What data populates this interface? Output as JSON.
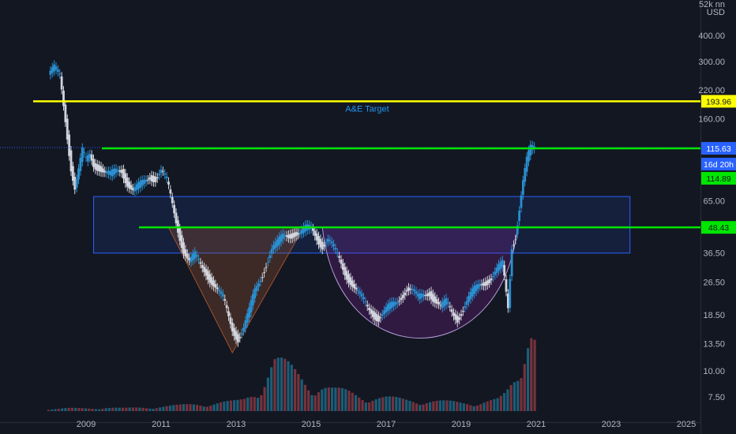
{
  "chart_data": {
    "type": "candlestick",
    "scale": "log",
    "currency": "USD",
    "header_text": "52k nn",
    "x_ticks": [
      "2009",
      "2011",
      "2013",
      "2015",
      "2017",
      "2019",
      "2021",
      "2023",
      "2025"
    ],
    "y_ticks": [
      400.0,
      300.0,
      220.0,
      160.0,
      65.0,
      36.5,
      26.5,
      18.5,
      13.5,
      10.0,
      7.5
    ],
    "y_tick_labels": [
      "400.00",
      "300.00",
      "220.00",
      "160.00",
      "65.00",
      "36.50",
      "26.50",
      "18.50",
      "13.50",
      "10.00",
      "7.50"
    ],
    "levels": [
      {
        "name": "A&E Target",
        "value": 193.96,
        "label": "193.96",
        "color": "#ffff00"
      },
      {
        "name": "",
        "value": 115.63,
        "label": "115.63",
        "color": "#00e600"
      },
      {
        "name": "",
        "value": 48.43,
        "label": "48.43",
        "color": "#00e600"
      }
    ],
    "price_tags": [
      {
        "label": "115.63",
        "color": "#2962ff"
      },
      {
        "label": "16d 20h",
        "color": "#2962ff"
      },
      {
        "label": "114.89",
        "color": "#00e600"
      },
      {
        "label": "48.43",
        "color": "#00e600"
      }
    ],
    "annotations": [
      {
        "text": "A&E Target",
        "color": "#2196f3"
      }
    ],
    "zone": {
      "from_year": 2009.2,
      "to_year": 2023.5,
      "low": 36.5,
      "high": 68,
      "color": "#2962ff"
    },
    "patterns": [
      {
        "type": "triangle",
        "color": "#a0522d",
        "points": [
          [
            2011.2,
            48.4
          ],
          [
            2012.9,
            12.2
          ],
          [
            2014.8,
            48.4
          ]
        ]
      },
      {
        "type": "cup",
        "color": "#9c27b0",
        "from_year": 2015.3,
        "to_year": 2020.5,
        "top": 48.4,
        "bottom": 13.5
      }
    ],
    "series": [
      {
        "name": "",
        "type": "monthly_close",
        "x": [
          2008.0,
          2008.15,
          2008.3,
          2008.45,
          2008.6,
          2008.7,
          2008.8,
          2008.9,
          2009.0,
          2009.1,
          2009.2,
          2009.35,
          2009.5,
          2009.65,
          2009.8,
          2009.95,
          2010.1,
          2010.25,
          2010.4,
          2010.55,
          2010.7,
          2010.85,
          2011.0,
          2011.15,
          2011.3,
          2011.45,
          2011.6,
          2011.75,
          2011.9,
          2012.05,
          2012.2,
          2012.35,
          2012.5,
          2012.65,
          2012.8,
          2012.9,
          2013.05,
          2013.2,
          2013.35,
          2013.5,
          2013.65,
          2013.8,
          2013.95,
          2014.1,
          2014.25,
          2014.4,
          2014.55,
          2014.7,
          2014.85,
          2015.0,
          2015.15,
          2015.3,
          2015.45,
          2015.6,
          2015.75,
          2015.9,
          2016.05,
          2016.2,
          2016.35,
          2016.5,
          2016.65,
          2016.8,
          2016.95,
          2017.1,
          2017.25,
          2017.4,
          2017.55,
          2017.7,
          2017.85,
          2018.0,
          2018.15,
          2018.3,
          2018.45,
          2018.6,
          2018.75,
          2018.9,
          2019.05,
          2019.2,
          2019.35,
          2019.5,
          2019.65,
          2019.8,
          2019.95,
          2020.1,
          2020.25,
          2020.35,
          2020.45,
          2020.55,
          2020.65,
          2020.75,
          2020.85,
          2020.95
        ],
        "y": [
          260,
          275,
          255,
          160,
          95,
          75,
          90,
          110,
          100,
          108,
          98,
          95,
          88,
          85,
          90,
          92,
          80,
          72,
          75,
          80,
          86,
          84,
          90,
          80,
          62,
          48,
          38,
          33,
          35,
          32,
          30,
          27,
          24,
          22,
          18,
          16,
          14.5,
          16,
          19,
          24,
          28,
          33,
          38,
          40,
          44,
          45,
          46,
          45,
          47,
          48,
          44,
          40,
          42,
          38,
          34,
          30,
          27,
          24,
          22,
          20,
          19,
          18,
          19,
          20,
          21,
          23,
          25,
          24,
          22,
          23,
          24,
          22,
          20,
          21,
          19,
          18,
          20,
          22,
          24,
          26,
          27,
          28,
          30,
          32,
          20,
          40,
          45,
          60,
          80,
          100,
          114,
          116
        ]
      },
      {
        "name": "",
        "type": "volume",
        "x": [
          2008.0,
          2008.5,
          2009.0,
          2009.5,
          2010.0,
          2010.5,
          2011.0,
          2011.5,
          2012.0,
          2012.5,
          2013.0,
          2013.2,
          2013.4,
          2013.6,
          2013.8,
          2014.0,
          2014.2,
          2014.4,
          2014.6,
          2014.8,
          2015.0,
          2015.3,
          2015.6,
          2016.0,
          2016.5,
          2017.0,
          2017.5,
          2018.0,
          2018.5,
          2019.0,
          2019.5,
          2020.0,
          2020.2,
          2020.4,
          2020.5,
          2020.6,
          2020.7,
          2020.8,
          2020.9,
          2021.0
        ],
        "y": [
          2,
          3,
          3,
          4,
          3,
          4,
          5,
          6,
          8,
          9,
          10,
          12,
          18,
          25,
          40,
          55,
          50,
          45,
          40,
          35,
          30,
          28,
          22,
          20,
          16,
          14,
          12,
          12,
          10,
          9,
          10,
          12,
          18,
          30,
          35,
          45,
          80,
          140,
          120,
          90
        ]
      }
    ]
  }
}
